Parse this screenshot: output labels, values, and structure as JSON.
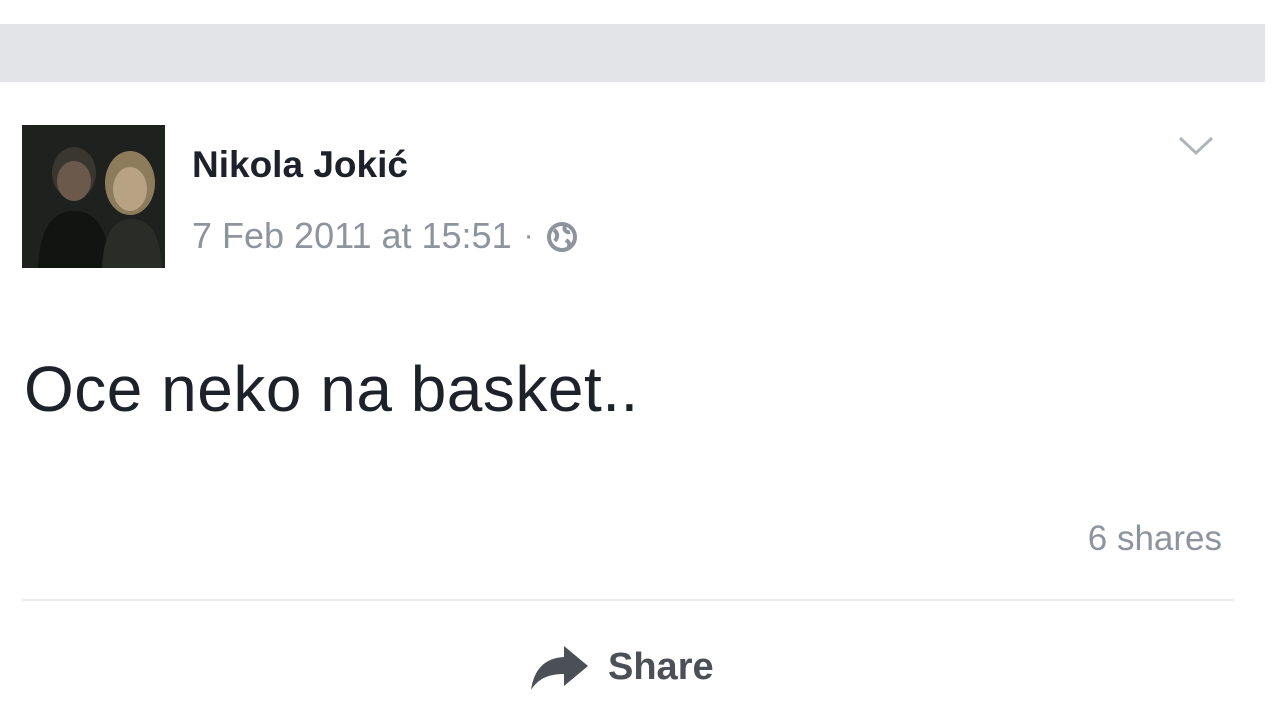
{
  "post": {
    "author": "Nikola Jokić",
    "timestamp": "7 Feb 2011 at 15:51",
    "separator": "·",
    "audience_icon": "globe-icon",
    "options_icon": "chevron-down-icon",
    "text": "Oce neko na basket..",
    "shares": "6 shares",
    "actions": {
      "share_label": "Share",
      "share_icon": "share-arrow-icon"
    }
  },
  "colors": {
    "top_bar": "#e3e4e8",
    "name": "#1d2129",
    "meta": "#8d949e",
    "action": "#4b4f56",
    "divider": "#e9ebee"
  }
}
